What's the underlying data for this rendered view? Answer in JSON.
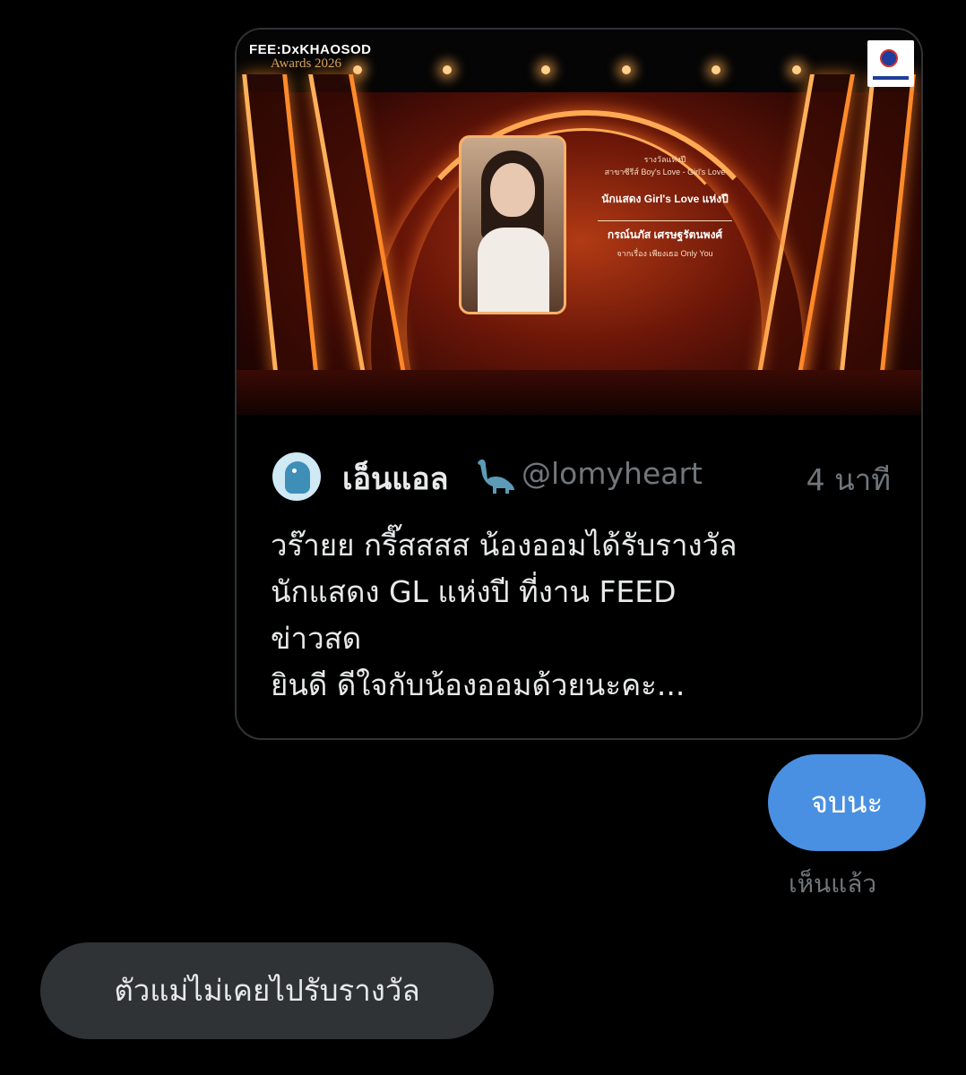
{
  "quoted_tweet": {
    "media": {
      "logo_text": "FEE:DxKHAOSOD",
      "logo_sub": "Awards 2026",
      "screen_lines": [
        "รางวัลแห่งปี",
        "สาขาซีรีส์ Boy's Love - Girl's Love",
        "นักแสดง Girl's Love แห่งปี",
        "กรณ์นภัส เศรษฐรัตนพงศ์",
        "จากเรื่อง เพียงเธอ Only You"
      ]
    },
    "author": {
      "display_name": "เอ็นแอล",
      "handle": "@lomyheart",
      "time": "4 นาที",
      "emoji_icon": "sauropod-icon"
    },
    "text": "วร๊ายย กรี๊สสสส น้องออมได้รับรางวัล\nนักแสดง GL แห่งปี ที่งาน FEED\nข่าวสด\nยินดี ดีใจกับน้องออมด้วยนะคะ..."
  },
  "messages": {
    "sent": "จบนะ",
    "seen_status": "เห็นแล้ว",
    "received": "ตัวแม่ไม่เคยไปรับรางวัล"
  },
  "colors": {
    "background": "#000000",
    "sent_bubble": "#4a90e2",
    "received_bubble": "#2f3336",
    "muted_text": "#71767b"
  }
}
